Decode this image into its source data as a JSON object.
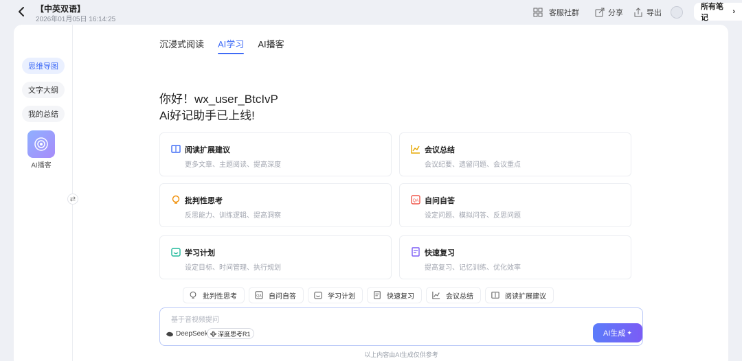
{
  "header": {
    "title": "【中英双语】",
    "timestamp": "2026年01月05日 16:14:25",
    "actions": [
      {
        "label": "客服社群",
        "icon": "grid-icon"
      },
      {
        "label": "分享",
        "icon": "share-icon"
      },
      {
        "label": "导出",
        "icon": "export-icon"
      }
    ],
    "all_notes": "所有笔记"
  },
  "sidebar": {
    "items": [
      "思维导图",
      "文字大纲",
      "我的总结"
    ],
    "podcast_label": "AI播客",
    "swap_glyph": "⇄"
  },
  "tabs": [
    "沉浸式阅读",
    "AI学习",
    "AI播客"
  ],
  "greeting": {
    "line1": "你好！wx_user_BtcIvP",
    "line2": "Ai好记助手已上线!"
  },
  "cards": [
    {
      "title": "阅读扩展建议",
      "desc": "更多文章、主题阅读、提高深度",
      "icon": "book-icon",
      "color": "#3f6bf6"
    },
    {
      "title": "会议总结",
      "desc": "会议纪要、遗留问题、会议重点",
      "icon": "chart-icon",
      "color": "#e6a700"
    },
    {
      "title": "批判性思考",
      "desc": "反思能力、训练逻辑、提高洞察",
      "icon": "bulb-icon",
      "color": "#f08c00"
    },
    {
      "title": "自问自答",
      "desc": "设定问题、模拟问答、反思问题",
      "icon": "qa-icon",
      "color": "#f0564a"
    },
    {
      "title": "学习计划",
      "desc": "设定目标、时间管理、执行规划",
      "icon": "plan-icon",
      "color": "#1fb89a"
    },
    {
      "title": "快速复习",
      "desc": "提高复习、记忆训练、优化效率",
      "icon": "review-icon",
      "color": "#7b5cf5"
    }
  ],
  "chips": [
    {
      "label": "批判性思考",
      "icon": "bulb-icon"
    },
    {
      "label": "自问自答",
      "icon": "qa-icon"
    },
    {
      "label": "学习计划",
      "icon": "plan-icon"
    },
    {
      "label": "快速复习",
      "icon": "review-icon"
    },
    {
      "label": "会议总结",
      "icon": "chart-icon"
    },
    {
      "label": "阅读扩展建议",
      "icon": "book-icon"
    }
  ],
  "input": {
    "placeholder": "基于音视频提问",
    "model": "DeepSeek",
    "r1_label": "深度思考R1",
    "generate": "AI生成"
  },
  "disclaimer": "以上内容由AI生成仅供参考"
}
